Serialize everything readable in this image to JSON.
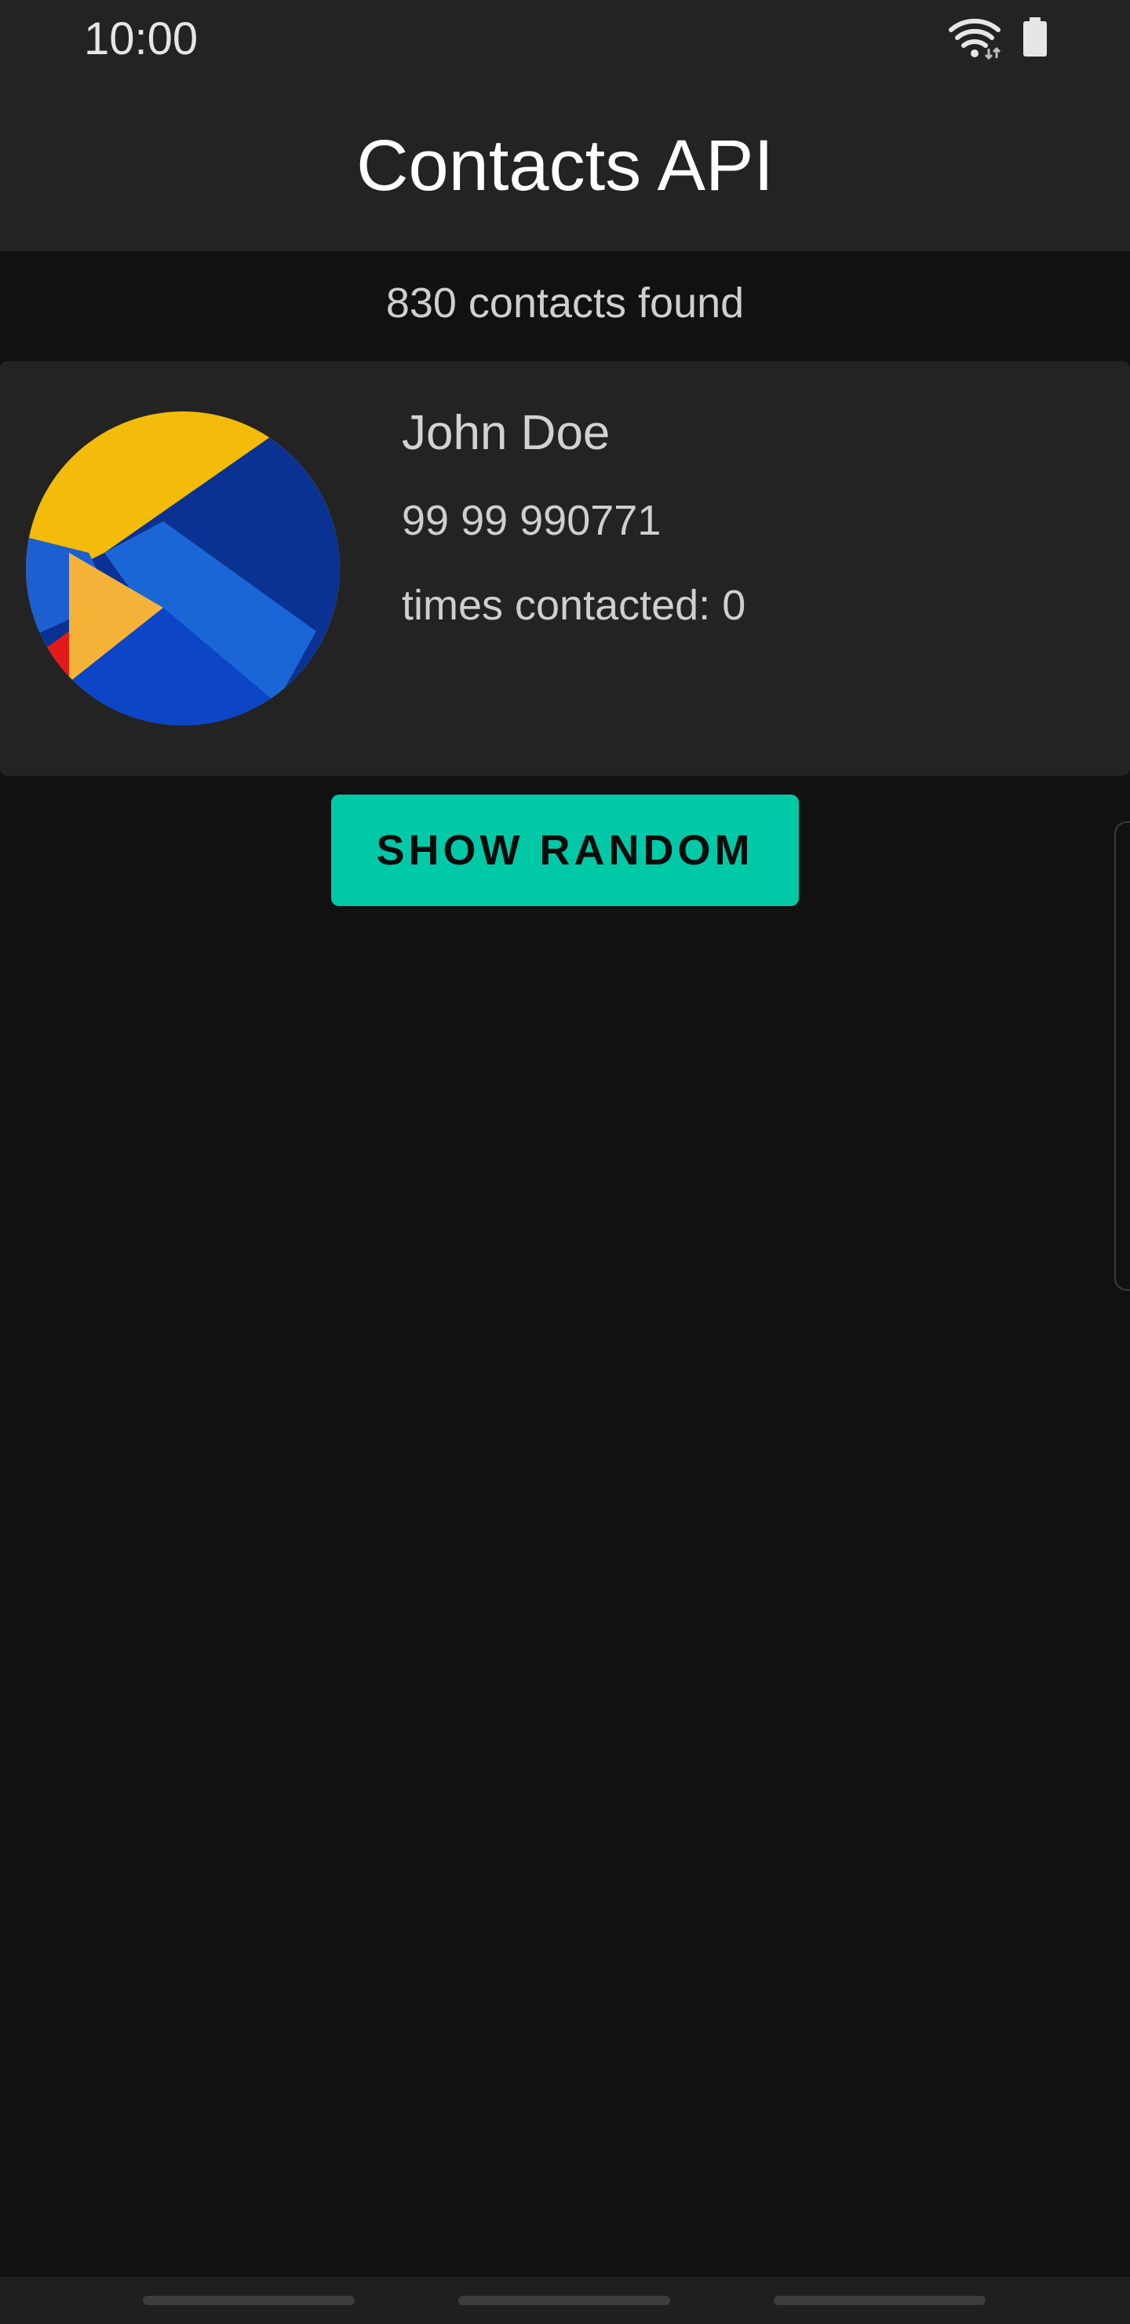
{
  "status_bar": {
    "time": "10:00",
    "icons": [
      "wifi-icon",
      "battery-icon"
    ]
  },
  "app_bar": {
    "title": "Contacts API"
  },
  "summary": {
    "count_text": "830 contacts found"
  },
  "contact": {
    "avatar": "avatar-image",
    "name": "John Doe",
    "phone": "99 99 990771",
    "times_contacted": "times contacted: 0"
  },
  "actions": {
    "show_random_label": "SHOW RANDOM"
  },
  "colors": {
    "background": "#111111",
    "app_bar": "#232323",
    "card": "#232323",
    "accent": "#00c9a7"
  }
}
